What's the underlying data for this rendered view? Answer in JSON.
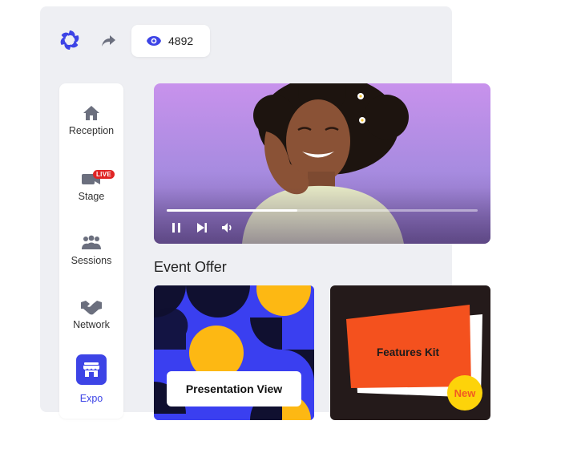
{
  "header": {
    "viewer_count": "4892",
    "logo_icon": "swirl-logo-icon",
    "share_icon": "share-arrow-icon",
    "eye_icon": "eye-icon"
  },
  "sidebar": {
    "items": [
      {
        "label": "Reception",
        "icon": "home-icon"
      },
      {
        "label": "Stage",
        "icon": "video-camera-icon",
        "badge": "LIVE"
      },
      {
        "label": "Sessions",
        "icon": "people-group-icon"
      },
      {
        "label": "Network",
        "icon": "handshake-icon"
      },
      {
        "label": "Expo",
        "icon": "storefront-icon",
        "active": true
      }
    ]
  },
  "video": {
    "progress_fraction": 0.42,
    "controls": [
      "pause-icon",
      "skip-next-icon",
      "volume-icon"
    ]
  },
  "offers": {
    "title": "Event Offer",
    "cards": [
      {
        "button_label": "Presentation View"
      },
      {
        "label": "Features Kit",
        "badge": "New"
      }
    ]
  },
  "colors": {
    "accent": "#3d44e6",
    "live_red": "#e02424",
    "offer_yellow": "#fdb813",
    "kit_orange": "#f4511e",
    "new_badge": "#fdd30a"
  }
}
